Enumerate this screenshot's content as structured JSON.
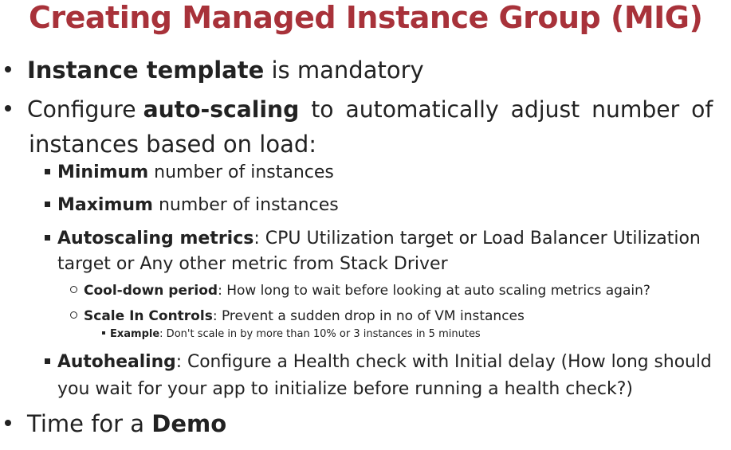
{
  "title": "Creating Managed Instance Group (MIG)",
  "bullets": {
    "b1": {
      "bold": "Instance template",
      "rest": " is mandatory"
    },
    "b2": {
      "lead": "Configure ",
      "bold": "auto-scaling",
      "rest1": " to automatically adjust number of",
      "rest2": "instances based on load:"
    },
    "s1": {
      "bold": "Minimum",
      "rest": " number of instances"
    },
    "s2": {
      "bold": "Maximum",
      "rest": " number of instances"
    },
    "s3": {
      "bold": "Autoscaling metrics",
      "rest1": ": CPU Utilization target or Load Balancer Utilization",
      "rest2": "target or Any other metric from Stack Driver"
    },
    "t1": {
      "bold": "Cool-down period",
      "rest": ": How long to wait before looking at auto scaling metrics again?"
    },
    "t2": {
      "bold": "Scale In Controls",
      "rest": ": Prevent a sudden drop in no of VM instances"
    },
    "q1": {
      "bold": "Example",
      "rest": ": Don't scale in by more than 10% or 3 instances in 5 minutes"
    },
    "s4": {
      "bold": "Autohealing",
      "rest1": ": Configure a Health check with Initial delay (How long should",
      "rest2": "you wait for your app to initialize before running a health check?)"
    },
    "b3": {
      "lead": "Time for a ",
      "bold": "Demo"
    }
  }
}
